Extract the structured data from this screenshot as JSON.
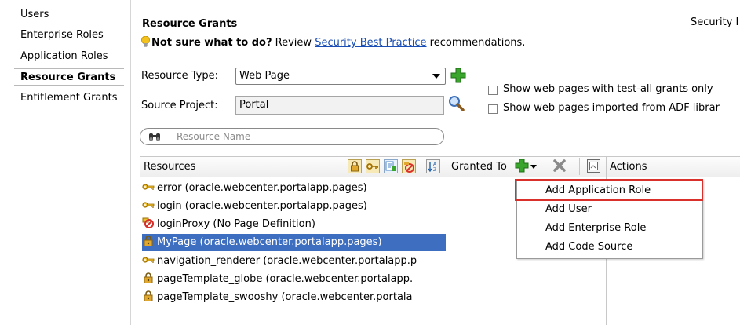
{
  "sidebar": {
    "items": [
      {
        "label": "Users"
      },
      {
        "label": "Enterprise Roles"
      },
      {
        "label": "Application Roles"
      },
      {
        "label": "Resource Grants"
      },
      {
        "label": "Entitlement Grants"
      }
    ]
  },
  "header": {
    "title": "Resource Grants",
    "right_text": "Security I"
  },
  "hint": {
    "bold": "Not sure what to do?",
    "text1": " Review ",
    "link": "Security Best Practice",
    "text2": " recommendations."
  },
  "form": {
    "resource_type_label": "Resource Type:",
    "resource_type_value": "Web Page",
    "source_project_label": "Source Project:",
    "source_project_value": "Portal",
    "checkbox1": "Show web pages with test-all grants only",
    "checkbox2": "Show web pages imported from ADF librar",
    "search_placeholder": "Resource Name"
  },
  "table": {
    "col_resources": "Resources",
    "col_granted_to": "Granted To",
    "col_actions": "Actions",
    "rows": [
      {
        "label": "error (oracle.webcenter.portalapp.pages)",
        "icon": "key-icon"
      },
      {
        "label": "login (oracle.webcenter.portalapp.pages)",
        "icon": "key-icon"
      },
      {
        "label": "loginProxy (No Page Definition)",
        "icon": "no-definition-icon"
      },
      {
        "label": "MyPage (oracle.webcenter.portalapp.pages)",
        "icon": "lock-icon",
        "selected": true
      },
      {
        "label": "navigation_renderer (oracle.webcenter.portalapp.p",
        "icon": "key-icon"
      },
      {
        "label": "pageTemplate_globe (oracle.webcenter.portalapp.",
        "icon": "lock-icon"
      },
      {
        "label": "pageTemplate_swooshy (oracle.webcenter.portala",
        "icon": "lock-icon"
      }
    ]
  },
  "menu": {
    "items": [
      {
        "label": "Add Application Role",
        "highlighted": true
      },
      {
        "label": "Add User"
      },
      {
        "label": "Add Enterprise Role"
      },
      {
        "label": "Add Code Source"
      }
    ]
  },
  "colors": {
    "selection": "#3d6ebf",
    "link": "#1a4eb4",
    "highlight_border": "#d9302c",
    "add_green": "#3aa52c"
  }
}
